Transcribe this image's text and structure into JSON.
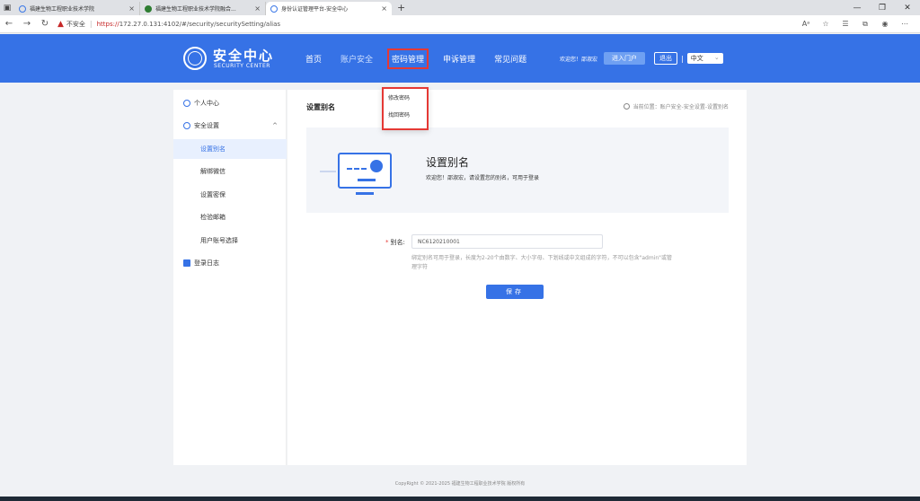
{
  "browser": {
    "tabs": [
      {
        "title": "福建生物工程职业技术学院",
        "active": false
      },
      {
        "title": "福建生物工程职业技术学院融合...",
        "active": false
      },
      {
        "title": "身份认证管理平台-安全中心",
        "active": true
      }
    ],
    "insecure_label": "不安全",
    "url_host": "https://",
    "url_rest": "172.27.0.131:4102/#/security/securitySetting/alias"
  },
  "header": {
    "brand_cn": "安全中心",
    "brand_en": "SECURITY CENTER",
    "menu": [
      {
        "label": "首页"
      },
      {
        "label": "账户安全"
      },
      {
        "label": "密码管理"
      },
      {
        "label": "申诉管理"
      },
      {
        "label": "常见问题"
      }
    ],
    "welcome": "欢迎您！邵淑宏",
    "portal_label": "进入门户",
    "logout_label": "退出",
    "lang_label": "中文"
  },
  "dropdown": {
    "items": [
      {
        "label": "修改密码"
      },
      {
        "label": "找回密码"
      }
    ]
  },
  "sidebar": {
    "items": [
      {
        "label": "个人中心"
      },
      {
        "label": "安全设置"
      },
      {
        "label": "设置别名"
      },
      {
        "label": "解绑微信"
      },
      {
        "label": "设置密保"
      },
      {
        "label": "检验邮箱"
      },
      {
        "label": "用户账号选择"
      },
      {
        "label": "登录日志"
      }
    ]
  },
  "main": {
    "title": "设置别名",
    "breadcrumb": "当前位置：账户安全-安全设置-设置别名",
    "banner_title": "设置别名",
    "banner_desc": "欢迎您！邵淑宏，请设置您的别名，可用于登录",
    "alias_label": "别名:",
    "alias_value": "NC6120210001",
    "hint": "绑定别名可用于登录，长度为2-20个由数字、大小字母、下划线或中文组成的字符，不可以包含\"admin\"或管理字符",
    "save_label": "保存"
  },
  "footer": {
    "copyright": "CopyRight © 2021-2025 福建生物工程职业技术学院 版权所有"
  },
  "colors": {
    "primary": "#3672e6",
    "highlight": "#e53935"
  }
}
